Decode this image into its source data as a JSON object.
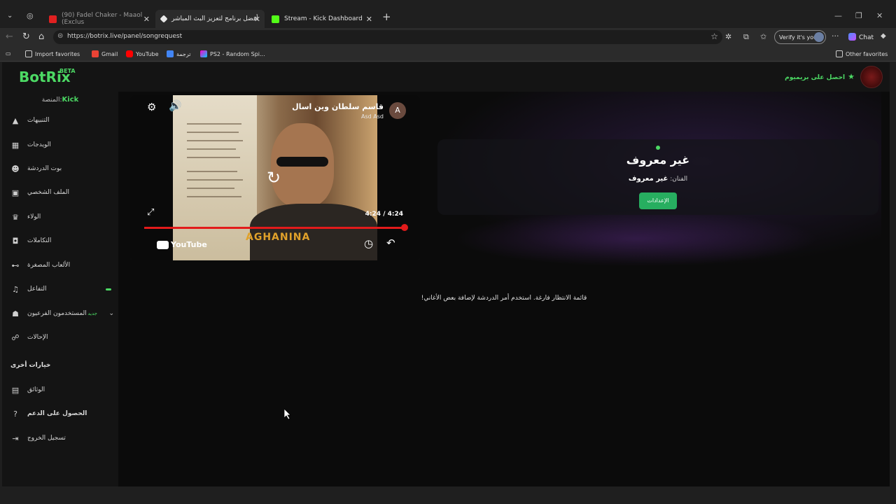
{
  "browser": {
    "tabs": [
      {
        "title": "(90) Fadel Chaker - Maaol (Exclus",
        "close": "✕"
      },
      {
        "title": "أفضل برنامج لتعزيز البث المباشر",
        "close": "✕"
      },
      {
        "title": "Stream - Kick Dashboard",
        "close": "✕"
      }
    ],
    "new_tab": "+",
    "url": "https://botrix.live/panel/songrequest",
    "verify_label": "Verify it's you",
    "chat_label": "Chat",
    "bookmarks": [
      "Import favorites",
      "Gmail",
      "YouTube",
      "ترجمة",
      "PS2 - Random Spi..."
    ],
    "other_favorites": "Other favorites",
    "colors": {
      "chrome_bg": "#1f1f1f",
      "toolbar_bg": "#2b2b2b"
    }
  },
  "app": {
    "logo": "BotRix",
    "logo_badge": "BETA",
    "premium": "احصل على بريميوم",
    "platform_label": "المنصة:",
    "platform_value": "Kick",
    "accent": "#4cd964",
    "nav": [
      {
        "label": "التنبيهات",
        "icon": "warning-icon"
      },
      {
        "label": "الويدجات",
        "icon": "widgets-icon"
      },
      {
        "label": "بوت الدردشة",
        "icon": "bot-icon"
      },
      {
        "label": "الملف الشخصي",
        "icon": "profile-icon"
      },
      {
        "label": "الولاء",
        "icon": "trophy-icon"
      },
      {
        "label": "التكاملات",
        "icon": "integrations-icon"
      },
      {
        "label": "الألعاب المصغرة",
        "icon": "gamepad-icon"
      },
      {
        "label": "التفاعل",
        "icon": "music-icon"
      },
      {
        "label": "المستخدمون الفرعيون",
        "icon": "users-icon",
        "tag": "جديد"
      },
      {
        "label": "الإحالات",
        "icon": "referral-icon"
      }
    ],
    "other_section": "خيارات أخرى",
    "other": [
      {
        "label": "الوثائق",
        "icon": "docs-icon"
      },
      {
        "label": "الحصول على الدعم",
        "icon": "help-icon"
      },
      {
        "label": "تسجيل الخروج",
        "icon": "logout-icon"
      }
    ]
  },
  "player": {
    "video_title": "قاسم سلطان وين اسال",
    "channel": "Asd Asd",
    "avatar_letter": "A",
    "time": "4:24 / 4:24",
    "brand": "AGHANINA",
    "youtube": "YouTube",
    "progress_fraction": 1.0
  },
  "now_playing": {
    "title": "غير معروف",
    "artist_label": "الفنان:",
    "artist_value": "غير معروف",
    "settings_button": "الإعدادات"
  },
  "queue_message": "قائمة الانتظار فارغة. استخدم أمر الدردشة لإضافة بعض الأغاني!"
}
